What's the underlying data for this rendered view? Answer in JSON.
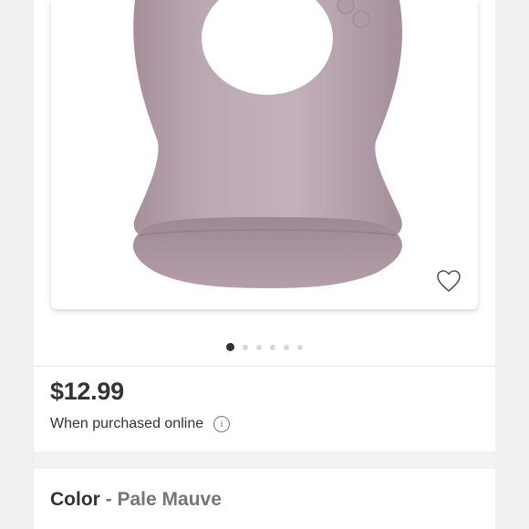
{
  "product": {
    "image": {
      "subject": "silicone-bib",
      "color_hex": "#b8a3ae",
      "favorite_icon": "heart-outline-icon"
    },
    "carousel": {
      "total_images": 6,
      "active_index": 0
    },
    "price": "$12.99",
    "purchase_note": "When purchased online",
    "info_icon_glyph": "i"
  },
  "color_selector": {
    "label": "Color",
    "separator": "-",
    "value": "Pale Mauve"
  },
  "colors": {
    "text": "#333333",
    "muted": "#767676",
    "bib": "#b8a3ae",
    "background": "#f2f2f2"
  }
}
